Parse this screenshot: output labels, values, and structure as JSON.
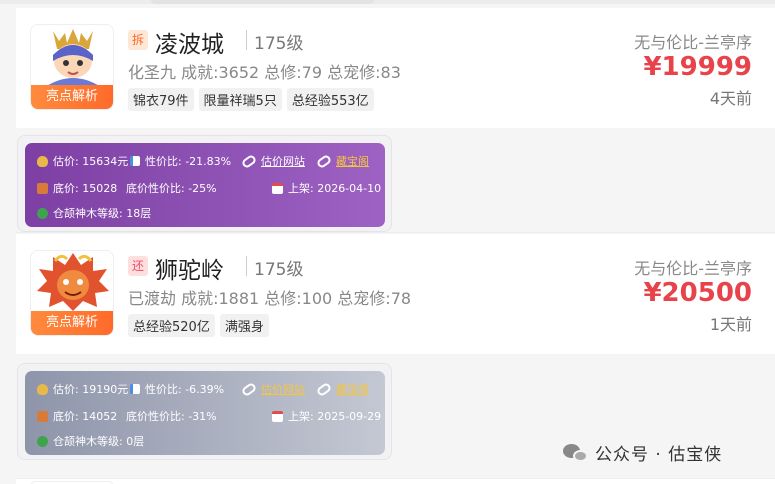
{
  "listings": [
    {
      "tag": "拆",
      "server": "凌波城",
      "level": "175级",
      "stats": "化圣九 成就:3652 总修:79 总宠修:83",
      "chips": [
        "锦衣79件",
        "限量祥瑞5只",
        "总经验553亿"
      ],
      "seller": "无与伦比-兰亭序",
      "price": "¥19999",
      "time": "4天前",
      "analysis_label": "亮点解析",
      "details": {
        "estimate": "估价: 15634元",
        "ratio": "性价比: -21.83%",
        "link1": "估价网站",
        "link2": "藏宝阁",
        "floor": "底价: 15028",
        "floor_ratio": "底价性价比: -25%",
        "listed": "上架: 2026-04-10",
        "tree": "仓颉神木等级: 18层"
      }
    },
    {
      "tag": "还",
      "server": "狮驼岭",
      "level": "175级",
      "stats": "已渡劫 成就:1881 总修:100 总宠修:78",
      "chips": [
        "总经验520亿",
        "满强身"
      ],
      "seller": "无与伦比-兰亭序",
      "price": "¥20500",
      "time": "1天前",
      "analysis_label": "亮点解析",
      "details": {
        "estimate": "估价: 19190元",
        "ratio": "性价比: -6.39%",
        "link1": "估价网站",
        "link2": "藏宝阁",
        "floor": "底价: 14052",
        "floor_ratio": "底价性价比: -31%",
        "listed": "上架: 2025-09-29",
        "tree": "仓颉神木等级: 0层"
      }
    }
  ],
  "watermark": "公众号 · 估宝侠",
  "colors": {
    "price": "#e8424a",
    "analysis": "#ff6a2a",
    "panel1": "#8a4fb3",
    "panel2": "#a3a9ba"
  }
}
